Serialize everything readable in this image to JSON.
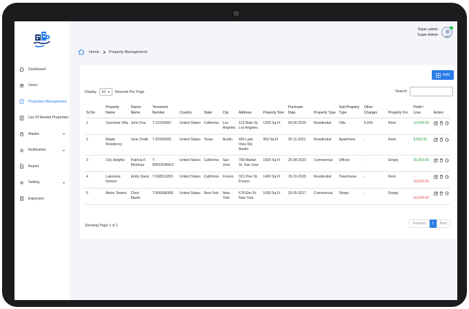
{
  "user": {
    "name": "Super admin",
    "role": "Super Admin"
  },
  "sidebar": {
    "items": [
      {
        "label": "Dashboard",
        "icon": "home-icon"
      },
      {
        "label": "Users",
        "icon": "users-icon"
      },
      {
        "label": "Properties Management",
        "icon": "building-icon",
        "active": true
      },
      {
        "label": "List Of Rented Properties",
        "icon": "list-icon"
      },
      {
        "label": "Master",
        "icon": "lock-icon",
        "expandable": true
      },
      {
        "label": "Notification",
        "icon": "bell-icon",
        "expandable": true
      },
      {
        "label": "Report",
        "icon": "report-icon"
      },
      {
        "label": "Setting",
        "icon": "gear-icon",
        "expandable": true
      },
      {
        "label": "Expenses",
        "icon": "receipt-icon"
      }
    ]
  },
  "breadcrumb": {
    "home": "Home",
    "current": "Property Management"
  },
  "toolbar": {
    "add_label": "Add"
  },
  "table_controls": {
    "display_label": "Display",
    "page_length": "10",
    "records_label": "Records Per Page",
    "search_label": "Search:",
    "search_value": ""
  },
  "table": {
    "columns": [
      "Sr.No",
      "Property Name",
      "Owner Name",
      "Tenement Number",
      "Country",
      "State",
      "City",
      "Address",
      "Property Size",
      "Purchase Date",
      "Property Type",
      "Sub Property Type",
      "Other Charges",
      "Property For",
      "Profit / Loss",
      "Action"
    ],
    "rows": [
      {
        "sr": "1",
        "property_name": "Sunshine Villa",
        "owner": "John Doe",
        "tenement": "T-10156662",
        "country": "United States",
        "state": "California",
        "city": "Los Angeles",
        "address": "123 Main St, Los Angeles",
        "size": "1200 Sq.Ft",
        "purchase": "03-06-2020",
        "type": "Residential",
        "subtype": "Villa",
        "charges": "5,000",
        "for": "Rent",
        "pl": "12,000.00",
        "pl_status": "profit"
      },
      {
        "sr": "2",
        "property_name": "Maple Residency",
        "owner": "Jane Smith",
        "tenement": "T-20256659",
        "country": "United States",
        "state": "Texas",
        "city": "Austin",
        "address": "456 Lake View Rd, Austin",
        "size": "950 Sq.Ft",
        "purchase": "25-11-2021",
        "type": "Residential",
        "subtype": "Apartment",
        "charges": "-",
        "for": "Rent",
        "pl": "8,550.00",
        "pl_status": "profit"
      },
      {
        "sr": "3",
        "property_name": "City Heights",
        "owner": "Patricia F. Montoya",
        "tenement": "T-80562548412",
        "country": "United States",
        "state": "California",
        "city": "San Jose",
        "address": "789 Market St, San Jose",
        "size": "1500 Sq.Ft",
        "purchase": "25-08-2023",
        "type": "Commercial",
        "subtype": "Offices",
        "charges": "-",
        "for": "Empty",
        "pl": "25,300.00",
        "pl_status": "profit"
      },
      {
        "sr": "4",
        "property_name": "Lakeview Homes",
        "owner": "Emily Davis",
        "tenement": "T-568913263",
        "country": "United States",
        "state": "California",
        "city": "Fresno",
        "address": "321 Pine St, Fresno",
        "size": "1400 Sq.Ft",
        "purchase": "15-10-2020",
        "type": "Residential",
        "subtype": "Townhouse",
        "charges": "-",
        "for": "Rent",
        "pl": "- 18,500.00",
        "pl_status": "loss"
      },
      {
        "sr": "5",
        "property_name": "Metro Towers",
        "owner": "Chris Martin",
        "tenement": "T-506688398",
        "country": "United States",
        "state": "New York",
        "city": "New York",
        "address": "678 Elm St, New York",
        "size": "1000 Sq.Ft",
        "purchase": "20-05-2017",
        "type": "Commercial",
        "subtype": "Shops",
        "charges": "-",
        "for": "Empty",
        "pl": "- 10,000.00",
        "pl_status": "loss"
      }
    ]
  },
  "footer": {
    "showing": "Showing Page 1 of 1",
    "prev": "Previous",
    "page": "1",
    "next": "Next"
  },
  "colors": {
    "accent": "#2b7de9",
    "profit": "#1f9d3a",
    "loss": "#e24b4b",
    "online": "#1fbf4a"
  }
}
